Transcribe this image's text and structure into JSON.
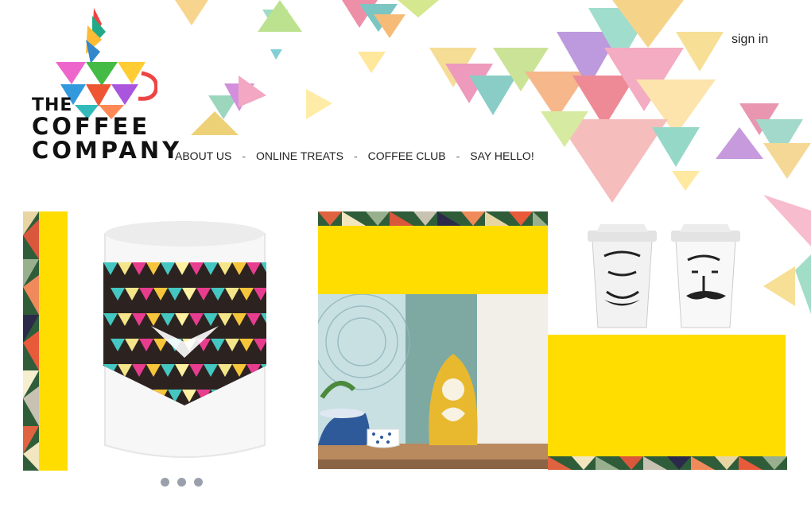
{
  "brand": {
    "line1": "THE",
    "line2": "COFFEE",
    "line3": "COMPANY"
  },
  "nav": {
    "items": [
      "ABOUT US",
      "ONLINE TREATS",
      "COFFEE CLUB",
      "SAY HELLO!"
    ],
    "separator": "-"
  },
  "account": {
    "signin_label": "sign in"
  },
  "slider": {
    "dot_count": 3
  },
  "colors": {
    "accent_yellow": "#ffdd00",
    "text": "#222222",
    "dot": "#9aa0ab"
  }
}
